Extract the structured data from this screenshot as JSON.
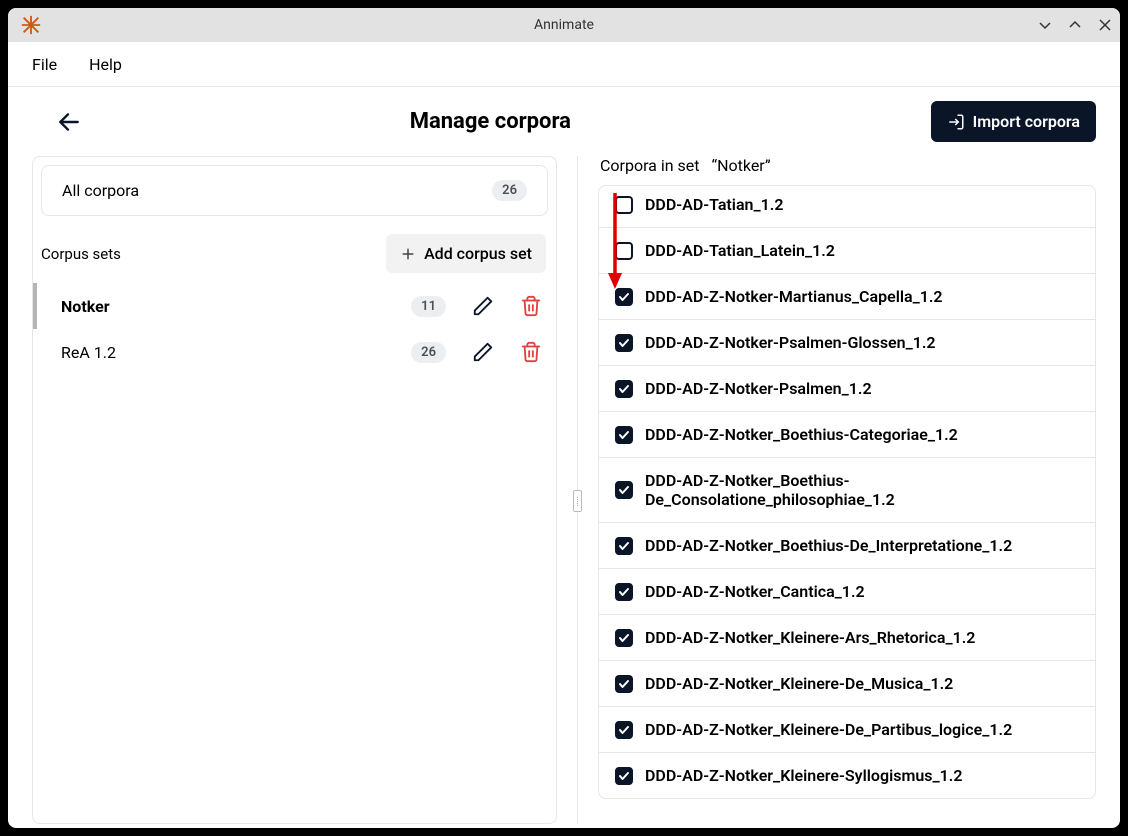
{
  "titlebar": {
    "title": "Annimate"
  },
  "menubar": {
    "file": "File",
    "help": "Help"
  },
  "header": {
    "page_title": "Manage corpora",
    "import_label": "Import corpora"
  },
  "left": {
    "all_corpora_label": "All corpora",
    "all_corpora_count": "26",
    "sets_label": "Corpus sets",
    "add_set_label": "Add corpus set",
    "sets": [
      {
        "name": "Notker",
        "count": "11",
        "active": true
      },
      {
        "name": "ReA 1.2",
        "count": "26",
        "active": false
      }
    ]
  },
  "right": {
    "title_prefix": "Corpora in set",
    "set_name_quoted": "“Notker”",
    "items": [
      {
        "name": "DDD-AD-Tatian_1.2",
        "checked": false
      },
      {
        "name": "DDD-AD-Tatian_Latein_1.2",
        "checked": false
      },
      {
        "name": "DDD-AD-Z-Notker-Martianus_Capella_1.2",
        "checked": true
      },
      {
        "name": "DDD-AD-Z-Notker-Psalmen-Glossen_1.2",
        "checked": true
      },
      {
        "name": "DDD-AD-Z-Notker-Psalmen_1.2",
        "checked": true
      },
      {
        "name": "DDD-AD-Z-Notker_Boethius-Categoriae_1.2",
        "checked": true
      },
      {
        "name": "DDD-AD-Z-Notker_Boethius-De_Consolatione_philosophiae_1.2",
        "checked": true
      },
      {
        "name": "DDD-AD-Z-Notker_Boethius-De_Interpretatione_1.2",
        "checked": true
      },
      {
        "name": "DDD-AD-Z-Notker_Cantica_1.2",
        "checked": true
      },
      {
        "name": "DDD-AD-Z-Notker_Kleinere-Ars_Rhetorica_1.2",
        "checked": true
      },
      {
        "name": "DDD-AD-Z-Notker_Kleinere-De_Musica_1.2",
        "checked": true
      },
      {
        "name": "DDD-AD-Z-Notker_Kleinere-De_Partibus_logice_1.2",
        "checked": true
      },
      {
        "name": "DDD-AD-Z-Notker_Kleinere-Syllogismus_1.2",
        "checked": true
      }
    ]
  }
}
